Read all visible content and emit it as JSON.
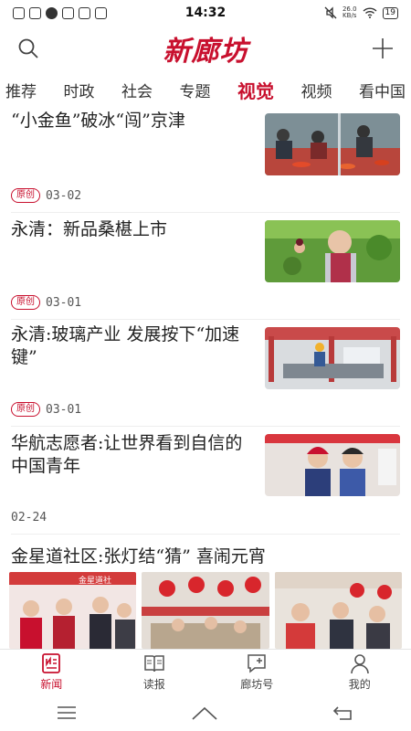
{
  "status_bar": {
    "time": "14:32",
    "net_speed_value": "26.0",
    "net_speed_unit": "KB/s",
    "battery": "19"
  },
  "header": {
    "logo_text": "新廊坊"
  },
  "tabs": [
    {
      "label": "推荐"
    },
    {
      "label": "时政"
    },
    {
      "label": "社会"
    },
    {
      "label": "专题"
    },
    {
      "label": "视觉"
    },
    {
      "label": "视频"
    },
    {
      "label": "看中国"
    }
  ],
  "news": [
    {
      "title": "“小金鱼”破冰“闯”京津",
      "badge": "原创",
      "date": "03-02"
    },
    {
      "title": "永清：新品桑椹上市",
      "badge": "原创",
      "date": "03-01"
    },
    {
      "title": "永清:玻璃产业 发展按下“加速键”",
      "badge": "原创",
      "date": "03-01"
    },
    {
      "title": "华航志愿者:让世界看到自信的中国青年",
      "badge": "",
      "date": "02-24"
    }
  ],
  "gallery": {
    "title": "金星道社区:张灯结“猜” 喜闹元宵",
    "sign_text": "金星道社"
  },
  "bottom_nav": [
    {
      "label": "新闻"
    },
    {
      "label": "读报"
    },
    {
      "label": "廊坊号"
    },
    {
      "label": "我的"
    }
  ],
  "colors": {
    "brand_red": "#c8102e"
  }
}
